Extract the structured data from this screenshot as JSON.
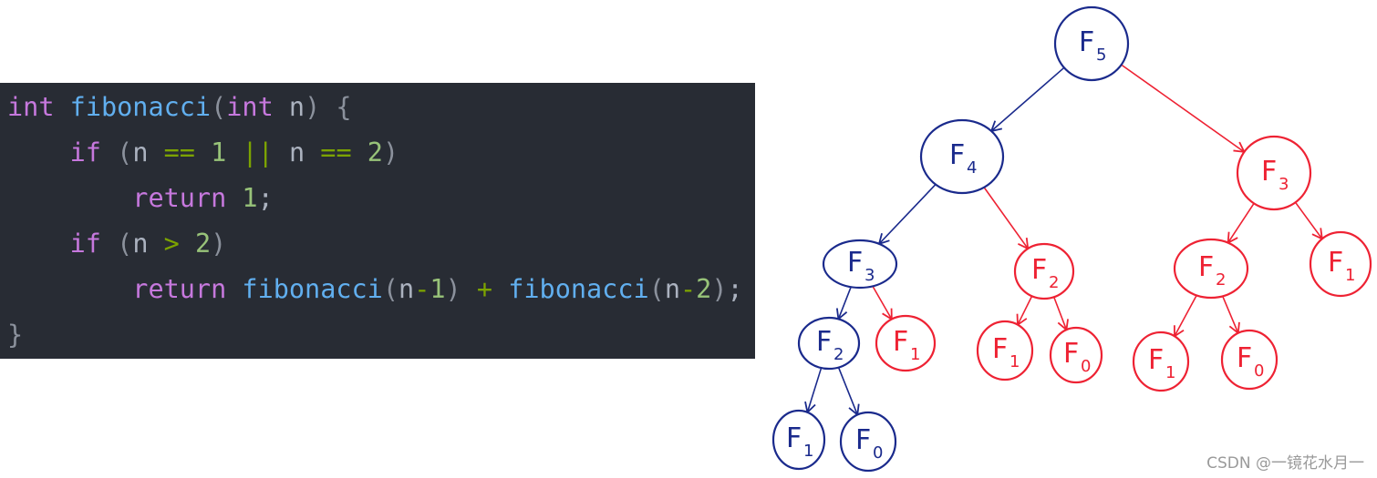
{
  "code": {
    "language": "c",
    "lines": [
      [
        [
          "kw",
          "int"
        ],
        [
          "id",
          " "
        ],
        [
          "fn",
          "fibonacci"
        ],
        [
          "pn",
          "("
        ],
        [
          "kw",
          "int"
        ],
        [
          "id",
          " n"
        ],
        [
          "pn",
          ")"
        ],
        [
          "id",
          " "
        ],
        [
          "pn",
          "{"
        ]
      ],
      [
        [
          "id",
          "    "
        ],
        [
          "kw",
          "if"
        ],
        [
          "id",
          " "
        ],
        [
          "pn",
          "("
        ],
        [
          "id",
          "n "
        ],
        [
          "op",
          "=="
        ],
        [
          "id",
          " "
        ],
        [
          "nm",
          "1"
        ],
        [
          "id",
          " "
        ],
        [
          "op",
          "||"
        ],
        [
          "id",
          " n "
        ],
        [
          "op",
          "=="
        ],
        [
          "id",
          " "
        ],
        [
          "nm",
          "2"
        ],
        [
          "pn",
          ")"
        ]
      ],
      [
        [
          "id",
          "        "
        ],
        [
          "kw",
          "return"
        ],
        [
          "id",
          " "
        ],
        [
          "nm",
          "1"
        ],
        [
          "id",
          ";"
        ]
      ],
      [
        [
          "id",
          "    "
        ],
        [
          "kw",
          "if"
        ],
        [
          "id",
          " "
        ],
        [
          "pn",
          "("
        ],
        [
          "id",
          "n "
        ],
        [
          "op",
          ">"
        ],
        [
          "id",
          " "
        ],
        [
          "nm",
          "2"
        ],
        [
          "pn",
          ")"
        ]
      ],
      [
        [
          "id",
          "        "
        ],
        [
          "kw",
          "return"
        ],
        [
          "id",
          " "
        ],
        [
          "fn",
          "fibonacci"
        ],
        [
          "pn",
          "("
        ],
        [
          "id",
          "n"
        ],
        [
          "op",
          "-"
        ],
        [
          "nm",
          "1"
        ],
        [
          "pn",
          ")"
        ],
        [
          "id",
          " "
        ],
        [
          "op",
          "+"
        ],
        [
          "id",
          " "
        ],
        [
          "fn",
          "fibonacci"
        ],
        [
          "pn",
          "("
        ],
        [
          "id",
          "n"
        ],
        [
          "op",
          "-"
        ],
        [
          "nm",
          "2"
        ],
        [
          "pn",
          ")"
        ],
        [
          "id",
          ";"
        ]
      ],
      [
        [
          "pn",
          "}"
        ]
      ]
    ]
  },
  "tree": {
    "colors": {
      "computed": "#1a2a8c",
      "repeated": "#ee2233"
    },
    "nodes": [
      {
        "id": "f5",
        "label": "F",
        "sub": "5",
        "kind": "computed"
      },
      {
        "id": "f4",
        "label": "F",
        "sub": "4",
        "kind": "computed"
      },
      {
        "id": "f3r",
        "label": "F",
        "sub": "3",
        "kind": "repeated"
      },
      {
        "id": "f3l",
        "label": "F",
        "sub": "3",
        "kind": "computed"
      },
      {
        "id": "f2m",
        "label": "F",
        "sub": "2",
        "kind": "repeated"
      },
      {
        "id": "f2r",
        "label": "F",
        "sub": "2",
        "kind": "repeated"
      },
      {
        "id": "f1rr",
        "label": "F",
        "sub": "1",
        "kind": "repeated"
      },
      {
        "id": "f2l",
        "label": "F",
        "sub": "2",
        "kind": "computed"
      },
      {
        "id": "f1a",
        "label": "F",
        "sub": "1",
        "kind": "repeated"
      },
      {
        "id": "f1b",
        "label": "F",
        "sub": "1",
        "kind": "repeated"
      },
      {
        "id": "f0b",
        "label": "F",
        "sub": "0",
        "kind": "repeated"
      },
      {
        "id": "f1c",
        "label": "F",
        "sub": "1",
        "kind": "repeated"
      },
      {
        "id": "f0c",
        "label": "F",
        "sub": "0",
        "kind": "repeated"
      },
      {
        "id": "f1d",
        "label": "F",
        "sub": "1",
        "kind": "computed"
      },
      {
        "id": "f0d",
        "label": "F",
        "sub": "0",
        "kind": "computed"
      }
    ],
    "edges": [
      [
        "f5",
        "f4",
        "computed"
      ],
      [
        "f5",
        "f3r",
        "repeated"
      ],
      [
        "f4",
        "f3l",
        "computed"
      ],
      [
        "f4",
        "f2m",
        "repeated"
      ],
      [
        "f3r",
        "f2r",
        "repeated"
      ],
      [
        "f3r",
        "f1rr",
        "repeated"
      ],
      [
        "f3l",
        "f2l",
        "computed"
      ],
      [
        "f3l",
        "f1a",
        "repeated"
      ],
      [
        "f2m",
        "f1b",
        "repeated"
      ],
      [
        "f2m",
        "f0b",
        "repeated"
      ],
      [
        "f2r",
        "f1c",
        "repeated"
      ],
      [
        "f2r",
        "f0c",
        "repeated"
      ],
      [
        "f2l",
        "f1d",
        "computed"
      ],
      [
        "f2l",
        "f0d",
        "computed"
      ]
    ]
  },
  "watermark": "CSDN @一镜花水月一"
}
